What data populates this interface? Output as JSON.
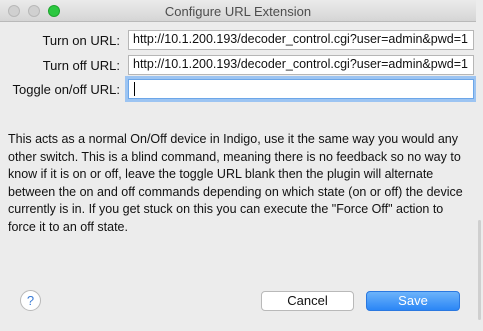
{
  "window": {
    "title": "Configure URL Extension"
  },
  "form": {
    "turn_on": {
      "label": "Turn on URL:",
      "value": "http://10.1.200.193/decoder_control.cgi?user=admin&pwd=1"
    },
    "turn_off": {
      "label": "Turn off URL:",
      "value": "http://10.1.200.193/decoder_control.cgi?user=admin&pwd=1"
    },
    "toggle": {
      "label": "Toggle on/off URL:",
      "value": ""
    }
  },
  "description": "This acts as a normal On/Off device in Indigo, use it the same way you would any other switch.  This is a blind command, meaning there is no feedback so no way to know if it is on or off, leave the toggle URL blank then the plugin will alternate between the on and off commands depending on which state (on or off) the device currently is in.  If you get stuck on this you can execute the \"Force Off\" action to force it to an off state.",
  "buttons": {
    "help": "?",
    "cancel": "Cancel",
    "save": "Save"
  },
  "colors": {
    "accent": "#2b86f6",
    "zoom_button": "#2bc840",
    "focus_ring": "#9cc4f2"
  },
  "icons": {
    "help": "question-mark-icon"
  }
}
